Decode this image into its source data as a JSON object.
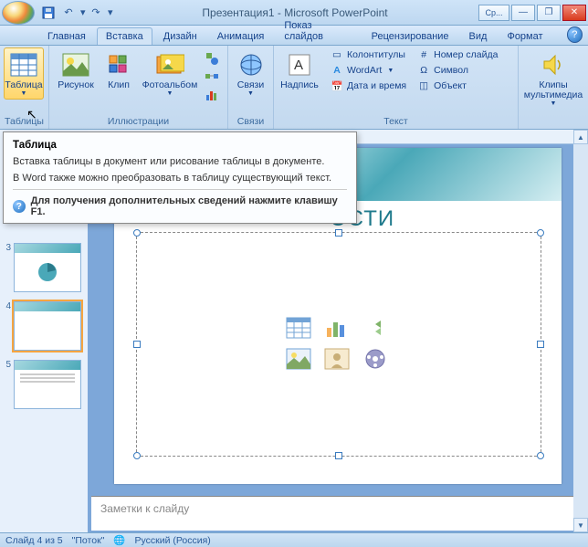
{
  "title": "Презентация1 - Microsoft PowerPoint",
  "spellcheck_btn": "Ср...",
  "tabs": {
    "home": "Главная",
    "insert": "Вставка",
    "design": "Дизайн",
    "animation": "Анимация",
    "slideshow": "Показ слайдов",
    "review": "Рецензирование",
    "view": "Вид",
    "format": "Формат"
  },
  "ribbon": {
    "tables": {
      "table": "Таблица",
      "group": "Таблицы"
    },
    "illustrations": {
      "picture": "Рисунок",
      "clip": "Клип",
      "photoalbum": "Фотоальбом",
      "group": "Иллюстрации"
    },
    "links": {
      "links": "Связи",
      "group": "Связи"
    },
    "text": {
      "textbox": "Надпись",
      "headerfooter": "Колонтитулы",
      "slidenumber": "Номер слайда",
      "wordart": "WordArt",
      "symbol": "Символ",
      "datetime": "Дата и время",
      "object": "Объект",
      "group": "Текст"
    },
    "media": {
      "clips": "Клипы\nмультимедиа",
      "group": ""
    }
  },
  "tooltip": {
    "title": "Таблица",
    "line1": "Вставка таблицы в документ или рисование таблицы в документе.",
    "line2": "В Word также можно преобразовать в таблицу существующий текст.",
    "help": "Для получения дополнительных сведений нажмите клавишу F1."
  },
  "slide": {
    "title_fragment": "ОСТИ"
  },
  "notes_placeholder": "Заметки к слайду",
  "status": {
    "slide_counter": "Слайд 4 из 5",
    "theme": "\"Поток\"",
    "lang": "Русский (Россия)"
  },
  "thumbs": [
    "3",
    "4",
    "5"
  ]
}
